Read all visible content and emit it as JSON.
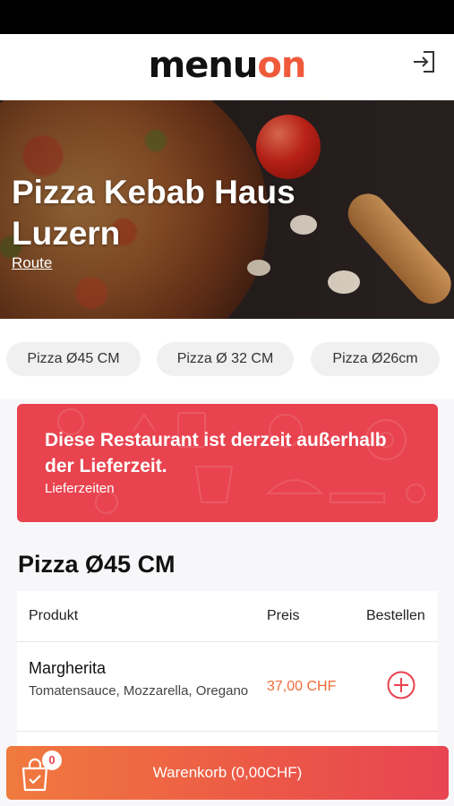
{
  "header": {
    "logo_part1": "menu",
    "logo_part2": "on",
    "login_icon": "login-icon"
  },
  "restaurant": {
    "name": "Pizza Kebab Haus Luzern",
    "route_label": "Route"
  },
  "categories": [
    {
      "label": "Pizza Ø45 CM"
    },
    {
      "label": "Pizza Ø 32 CM"
    },
    {
      "label": "Pizza Ø26cm"
    }
  ],
  "notice": {
    "message": "Diese Restaurant ist derzeit außerhalb der Lieferzeit.",
    "link": "Lieferzeiten"
  },
  "section": {
    "title": "Pizza Ø45 CM",
    "columns": {
      "product": "Produkt",
      "price": "Preis",
      "order": "Bestellen"
    },
    "items": [
      {
        "name": "Margherita",
        "description": "Tomatensauce, Mozzarella, Oregano",
        "price": "37,00 CHF",
        "add_icon": "plus-circle-icon"
      }
    ]
  },
  "cart": {
    "count": "0",
    "label": "Warenkorb (0,00CHF)",
    "icon": "shopping-bag-icon"
  },
  "colors": {
    "accent": "#f05a3c",
    "notice_bg": "#e8434f",
    "price": "#f26b3a"
  }
}
